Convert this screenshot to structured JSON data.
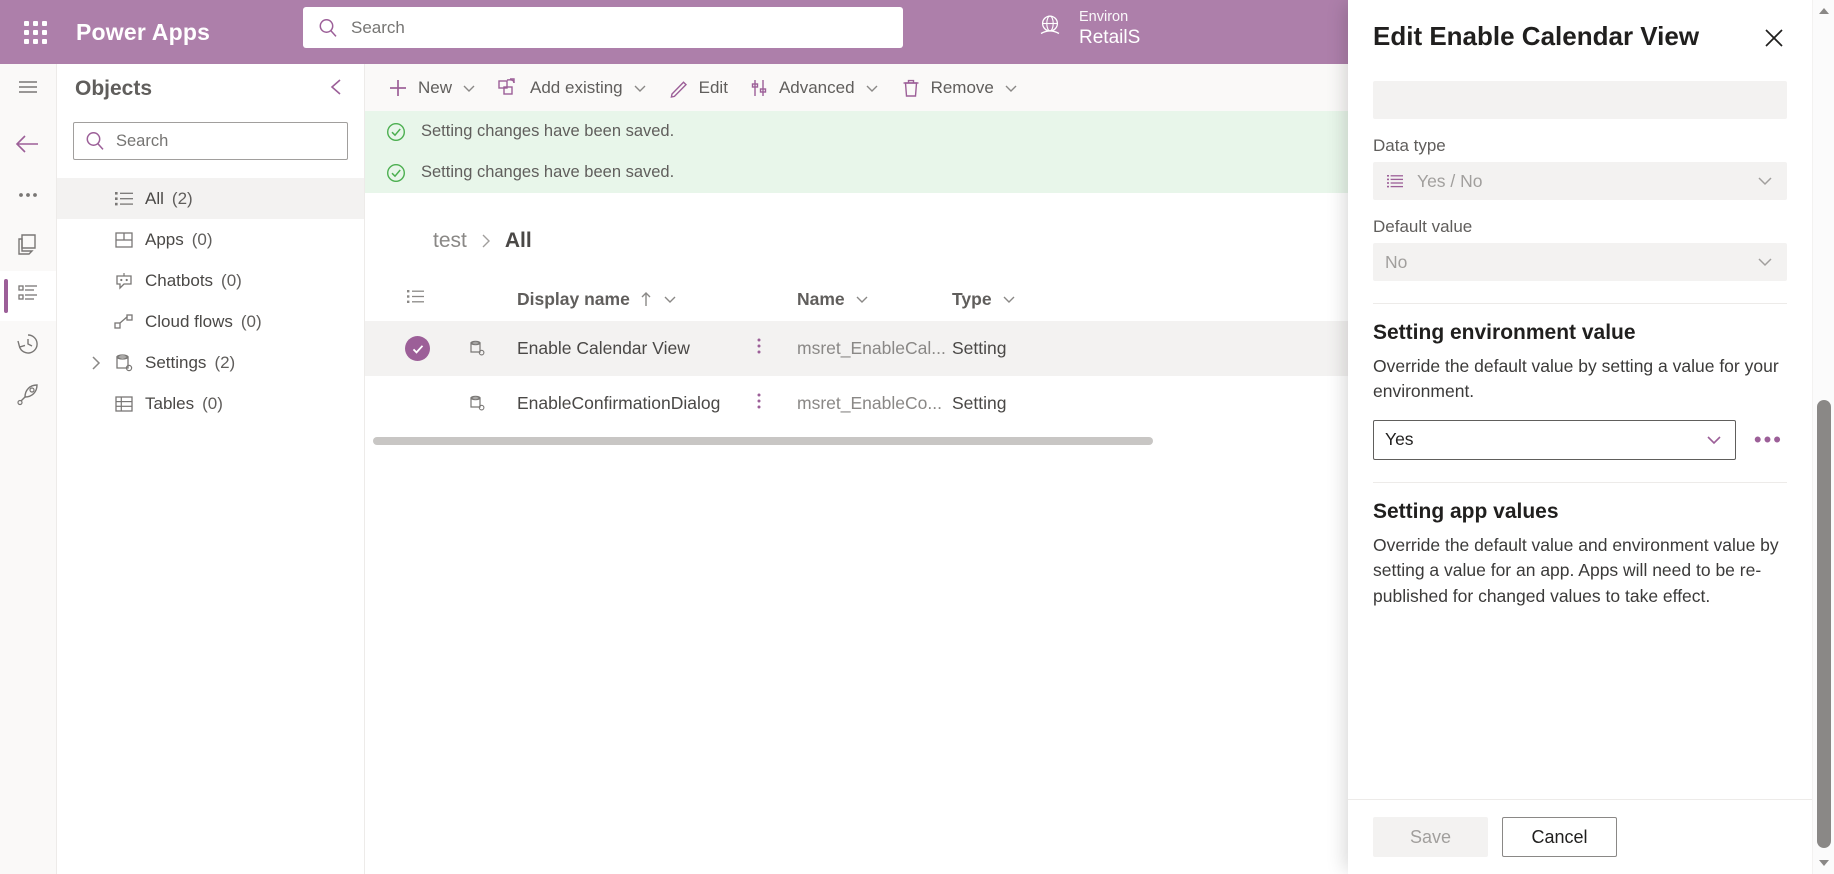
{
  "topbar": {
    "waffle_icon": "waffle-grid-icon",
    "brand": "Power Apps",
    "search_placeholder": "Search",
    "search_icon": "search-icon",
    "environment": {
      "icon": "globe-environment-icon",
      "label": "Environ",
      "value": "RetailS"
    }
  },
  "rail": {
    "items": [
      {
        "name": "hamburger-menu",
        "icon": "hamburger-icon"
      },
      {
        "name": "back",
        "icon": "arrow-left-icon"
      },
      {
        "name": "more",
        "icon": "ellipsis-icon"
      },
      {
        "name": "solutions",
        "icon": "solutions-icon"
      },
      {
        "name": "objects",
        "icon": "list-detail-icon"
      },
      {
        "name": "history",
        "icon": "history-clock-icon"
      },
      {
        "name": "publish",
        "icon": "rocket-icon"
      }
    ]
  },
  "objects": {
    "title": "Objects",
    "collapse_icon": "chevron-left-icon",
    "search_placeholder": "Search",
    "search_icon": "search-icon",
    "tree": [
      {
        "label": "All",
        "count": "(2)",
        "icon": "all-list-icon",
        "selected": true,
        "expandable": false
      },
      {
        "label": "Apps",
        "count": "(0)",
        "icon": "apps-grid-icon",
        "selected": false,
        "expandable": false
      },
      {
        "label": "Chatbots",
        "count": "(0)",
        "icon": "chatbot-icon",
        "selected": false,
        "expandable": false
      },
      {
        "label": "Cloud flows",
        "count": "(0)",
        "icon": "cloud-flow-icon",
        "selected": false,
        "expandable": false
      },
      {
        "label": "Settings",
        "count": "(2)",
        "icon": "settings-db-icon",
        "selected": false,
        "expandable": true
      },
      {
        "label": "Tables",
        "count": "(0)",
        "icon": "table-icon",
        "selected": false,
        "expandable": false
      }
    ]
  },
  "commandbar": {
    "items": [
      {
        "label": "New",
        "icon": "plus-icon",
        "caret": true
      },
      {
        "label": "Add existing",
        "icon": "add-existing-icon",
        "caret": true
      },
      {
        "label": "Edit",
        "icon": "pencil-icon",
        "caret": false
      },
      {
        "label": "Advanced",
        "icon": "advanced-icon",
        "caret": true
      },
      {
        "label": "Remove",
        "icon": "trash-icon",
        "caret": true
      }
    ]
  },
  "notifications": [
    {
      "icon": "check-circle-icon",
      "message": "Setting changes have been saved."
    },
    {
      "icon": "check-circle-icon",
      "message": "Setting changes have been saved."
    }
  ],
  "breadcrumb": {
    "parent": "test",
    "separator_icon": "chevron-right-icon",
    "current": "All"
  },
  "grid": {
    "header": {
      "select_all_icon": "select-columns-icon",
      "columns": [
        {
          "label": "Display name",
          "sorted": true,
          "sort_icon": "arrow-up-icon",
          "caret": true
        },
        {
          "label": "Name",
          "sorted": false,
          "caret": true
        },
        {
          "label": "Type",
          "sorted": false,
          "caret": true
        }
      ]
    },
    "rows": [
      {
        "selected": true,
        "check_icon": "check-icon",
        "row_icon": "setting-record-icon",
        "display_name": "Enable Calendar View",
        "kebab_icon": "more-vertical-icon",
        "name": "msret_EnableCal...",
        "type": "Setting"
      },
      {
        "selected": false,
        "check_icon": "check-icon",
        "row_icon": "setting-record-icon",
        "display_name": "EnableConfirmationDialog",
        "kebab_icon": "more-vertical-icon",
        "name": "msret_EnableCo...",
        "type": "Setting"
      }
    ],
    "hscrollbar": "horizontal-scrollbar"
  },
  "panel": {
    "title": "Edit Enable Calendar View",
    "close_icon": "close-icon",
    "display_name_value": "",
    "fields": [
      {
        "label": "Data type",
        "value": "Yes / No",
        "icon": "list-lines-icon",
        "chevron_icon": "chevron-down-icon",
        "disabled": true
      },
      {
        "label": "Default value",
        "value": "No",
        "chevron_icon": "chevron-down-icon",
        "disabled": true
      }
    ],
    "environment_section": {
      "title": "Setting environment value",
      "description": "Override the default value by setting a value for your environment.",
      "value": "Yes",
      "chevron_icon": "chevron-down-icon",
      "ellipsis_label": "•••",
      "ellipsis_icon": "ellipsis-icon"
    },
    "app_section": {
      "title": "Setting app values",
      "description": "Override the default value and environment value by setting a value for an app. Apps will need to be re-published for changed values to take effect."
    },
    "footer": {
      "save_label": "Save",
      "save_disabled": true,
      "cancel_label": "Cancel"
    }
  },
  "scrollbar": {
    "up_icon": "caret-up-icon",
    "down_icon": "caret-down-icon"
  },
  "colors": {
    "brand": "#ad7faa",
    "accent": "#9c5f98",
    "success_bg": "#e8f6ea",
    "success_fg": "#4caf50",
    "panel_bg": "#ffffff",
    "disabled_bg": "#f3f2f1"
  }
}
